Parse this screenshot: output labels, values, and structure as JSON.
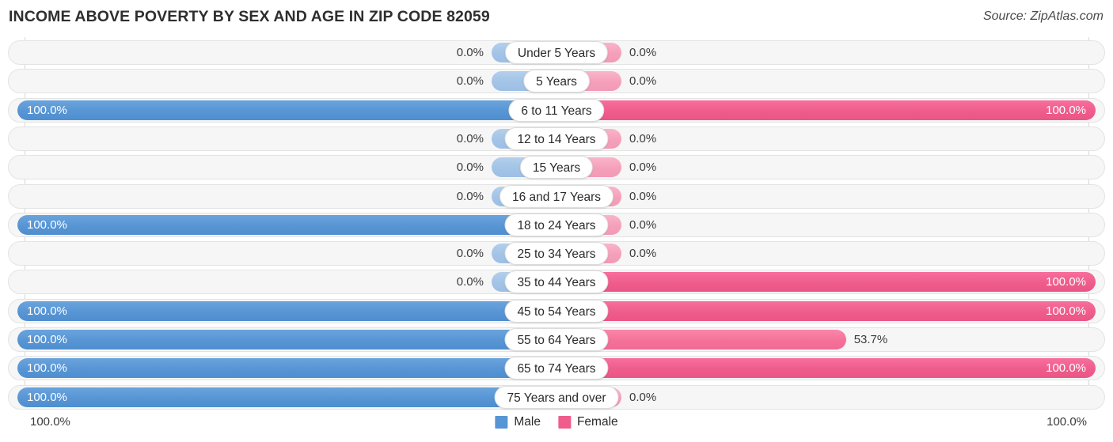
{
  "header": {
    "title": "INCOME ABOVE POVERTY BY SEX AND AGE IN ZIP CODE 82059",
    "source": "Source: ZipAtlas.com"
  },
  "footer": {
    "axis_left": "100.0%",
    "axis_right": "100.0%",
    "legend": [
      {
        "label": "Male",
        "color": "#5795d4"
      },
      {
        "label": "Female",
        "color": "#ef5d8c"
      }
    ]
  },
  "colors": {
    "male_full": "#5795d4",
    "male_stub": "#a3c4e7",
    "female_full": "#ef5d8c",
    "female_mid": "#f4719a",
    "female_stub": "#f5a0bb",
    "track": "#f6f6f6",
    "gridline": "#d7d7d7"
  },
  "chart_data": {
    "type": "bar",
    "subtype": "diverging-bidirectional",
    "title": "INCOME ABOVE POVERTY BY SEX AND AGE IN ZIP CODE 82059",
    "xlabel": "",
    "ylabel": "",
    "xlim": [
      0,
      100
    ],
    "grid": true,
    "legend_position": "bottom-center",
    "axis_ticks_left": [
      "100.0%"
    ],
    "axis_ticks_right": [
      "100.0%"
    ],
    "categories": [
      "Under 5 Years",
      "5 Years",
      "6 to 11 Years",
      "12 to 14 Years",
      "15 Years",
      "16 and 17 Years",
      "18 to 24 Years",
      "25 to 34 Years",
      "35 to 44 Years",
      "45 to 54 Years",
      "55 to 64 Years",
      "65 to 74 Years",
      "75 Years and over"
    ],
    "series": [
      {
        "name": "Male",
        "values": [
          0.0,
          0.0,
          100.0,
          0.0,
          0.0,
          0.0,
          100.0,
          0.0,
          0.0,
          100.0,
          100.0,
          100.0,
          100.0
        ],
        "labels": [
          "0.0%",
          "0.0%",
          "100.0%",
          "0.0%",
          "0.0%",
          "0.0%",
          "100.0%",
          "0.0%",
          "0.0%",
          "100.0%",
          "100.0%",
          "100.0%",
          "100.0%"
        ]
      },
      {
        "name": "Female",
        "values": [
          0.0,
          0.0,
          100.0,
          0.0,
          0.0,
          0.0,
          0.0,
          0.0,
          100.0,
          100.0,
          53.7,
          100.0,
          0.0
        ],
        "labels": [
          "0.0%",
          "0.0%",
          "100.0%",
          "0.0%",
          "0.0%",
          "0.0%",
          "0.0%",
          "0.0%",
          "100.0%",
          "100.0%",
          "53.7%",
          "100.0%",
          "0.0%"
        ]
      }
    ]
  }
}
